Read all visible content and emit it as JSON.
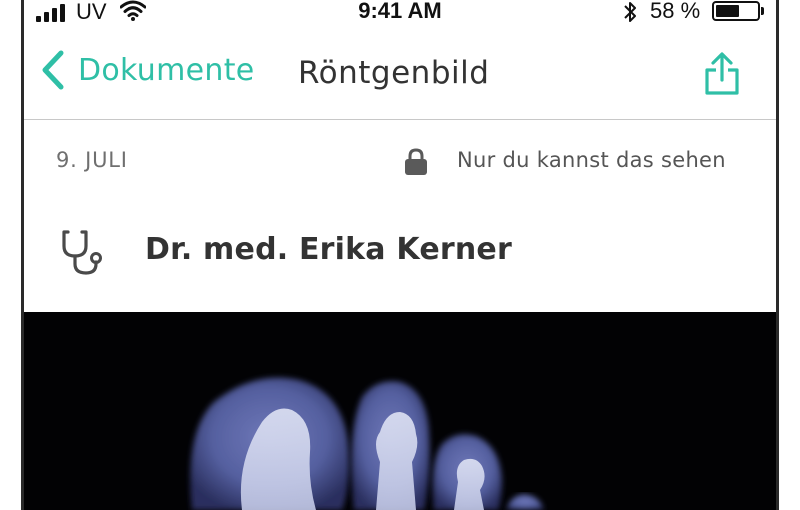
{
  "status_bar": {
    "carrier": "UV",
    "time": "9:41 AM",
    "battery_percent_label": "58 %",
    "battery_level": 0.58,
    "icons": [
      "signal-icon",
      "wifi-icon",
      "bluetooth-icon",
      "battery-icon"
    ]
  },
  "nav": {
    "back_label": "Dokumente",
    "title": "Röntgenbild",
    "share_icon": "share-icon",
    "back_icon": "chevron-left-icon"
  },
  "document": {
    "date": "9. JULI",
    "privacy_text": "Nur du kannst das sehen",
    "privacy_icon": "lock-icon",
    "doctor_icon": "stethoscope-icon",
    "doctor_name": "Dr. med. Erika Kerner",
    "image_subject": "x-ray-image"
  },
  "colors": {
    "accent": "#2fbfa6",
    "text_primary": "#333333",
    "text_secondary": "#6f6f6f",
    "divider": "#c8c8c8",
    "xray_background": "#020204"
  }
}
